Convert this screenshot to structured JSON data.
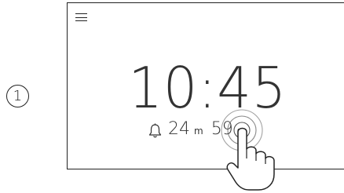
{
  "step": {
    "number": "1"
  },
  "device": {
    "menu_icon": "hamburger-menu-icon",
    "clock": {
      "time": "10:45"
    },
    "timer": {
      "icon": "bell-icon",
      "minutes": "24",
      "minutes_unit": "m",
      "seconds": "59",
      "seconds_unit": "s"
    }
  },
  "gesture": {
    "type": "tap",
    "target": "timer-seconds",
    "icon": "tapping-hand-icon"
  }
}
